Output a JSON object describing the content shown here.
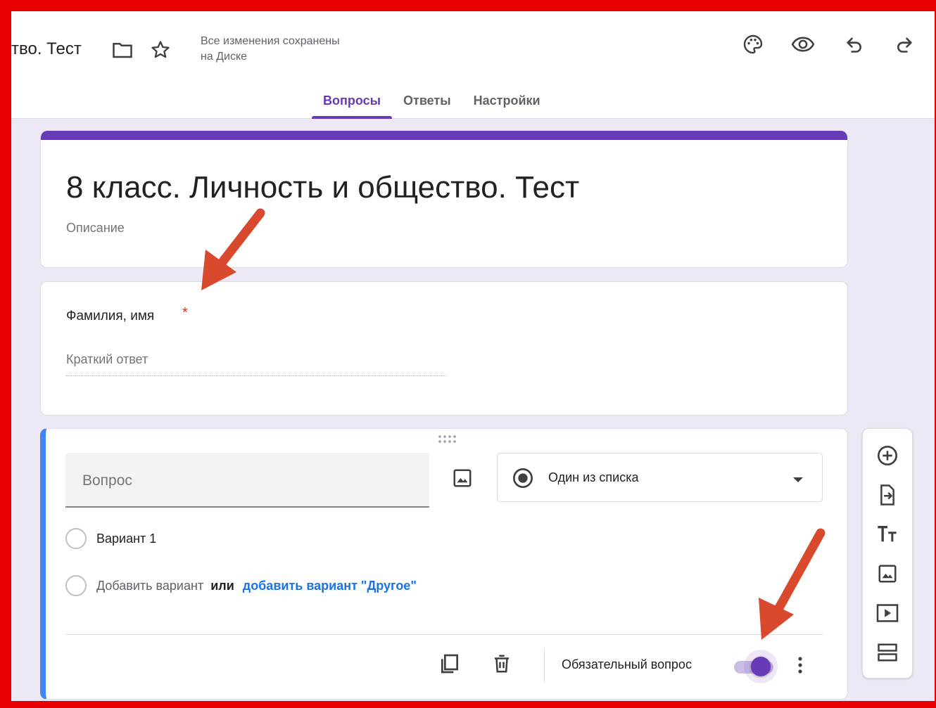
{
  "header": {
    "doc_title_fragment": "тво. Тест",
    "save_status_line1": "Все изменения сохранены",
    "save_status_line2": "на Диске",
    "icons": [
      "folder-icon",
      "star-icon",
      "palette-icon",
      "eye-icon",
      "undo-icon",
      "redo-icon"
    ]
  },
  "tabs": [
    {
      "label": "Вопросы",
      "active": true
    },
    {
      "label": "Ответы",
      "active": false
    },
    {
      "label": "Настройки",
      "active": false
    }
  ],
  "form": {
    "title": "8 класс. Личность и общество. Тест",
    "description_placeholder": "Описание"
  },
  "question1": {
    "title": "Фамилия, имя",
    "required_mark": "*",
    "answer_placeholder": "Краткий ответ"
  },
  "question2": {
    "title_placeholder": "Вопрос",
    "type_label": "Один из списка",
    "option1": "Вариант 1",
    "add_option": "Добавить вариант",
    "or": "или",
    "add_other": "добавить вариант \"Другое\"",
    "required_label": "Обязательный вопрос",
    "required_on": true
  },
  "side_toolbar": {
    "tools": [
      "add-question-icon",
      "import-questions-icon",
      "title-text-icon",
      "image-icon",
      "video-icon",
      "section-icon"
    ]
  },
  "colors": {
    "accent": "#673ab7",
    "active_question_bar": "#4285f4",
    "frame": "#e80000",
    "annotation_arrow": "#d9492e",
    "background": "#ede8f5"
  }
}
